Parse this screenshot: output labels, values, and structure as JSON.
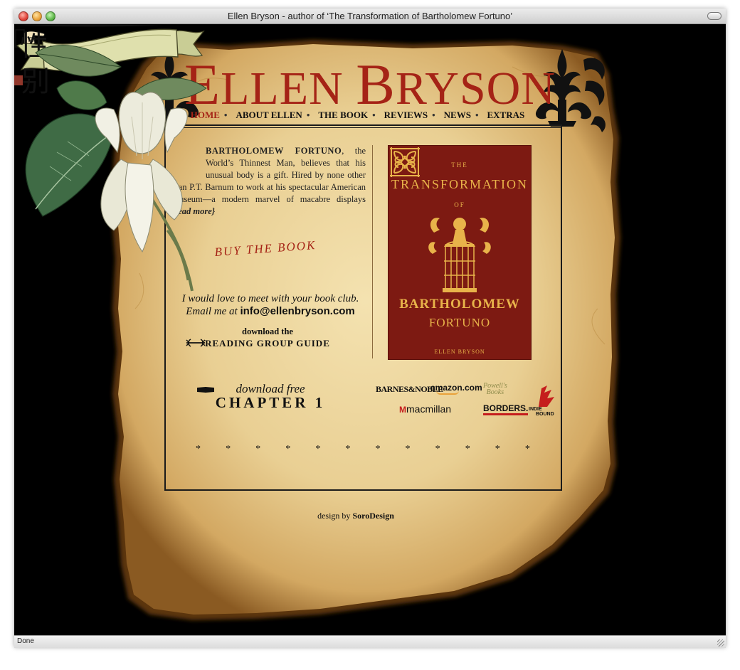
{
  "window": {
    "title": "Ellen Bryson - author of ‘The Transformation of Bartholomew Fortuno’",
    "status": "Done"
  },
  "header": {
    "title_first_cap": "E",
    "title_first_rest": "LLEN",
    "title_second_cap": "B",
    "title_second_rest": "RYSON"
  },
  "nav": {
    "items": [
      {
        "label": "HOME",
        "active": true
      },
      {
        "label": "ABOUT ELLEN"
      },
      {
        "label": "THE BOOK"
      },
      {
        "label": "REVIEWS"
      },
      {
        "label": "NEWS"
      },
      {
        "label": "EXTRAS"
      }
    ],
    "separator": "•"
  },
  "intro": {
    "name": "BARTHOLOMEW FORTUNO",
    "text": ", the World’s Thinnest Man, believes that his unusual body is a gift. Hired by none other than P.T. Barnum to work at his spectacular American Museum—a modern marvel of macabre displays ",
    "read_more": "{read more}"
  },
  "buy": {
    "label": "BUY THE BOOK"
  },
  "bookclub": {
    "line1": "I would love to meet with your book club.",
    "line2_prefix": "Email me at ",
    "email": "info@ellenbryson.com"
  },
  "guide": {
    "line1": "download the",
    "line2": "READING GROUP GUIDE"
  },
  "chapter": {
    "line1": "download free",
    "line2": "CHAPTER 1"
  },
  "cover": {
    "the": "THE",
    "title": "TRANSFORMATION",
    "of": "OF",
    "name1": "BARTHOLOMEW",
    "name2": "FORTUNO",
    "author": "ELLEN BRYSON",
    "colors": {
      "background": "#7d1a12",
      "ink": "#e8b34a"
    }
  },
  "retailers": {
    "bn": "BARNES&NOBLE",
    "amazon": "amazon.com",
    "powells_1": "Powell's",
    "powells_2": "Books",
    "macmillan_mark": "M",
    "macmillan": "macmillan",
    "borders": "BORDERS.",
    "indie_1": "INDIE",
    "indie_2": "BOUND"
  },
  "stars": [
    "*",
    "*",
    "*",
    "*",
    "*",
    "*",
    "*",
    "*",
    "*",
    "*",
    "*",
    "*"
  ],
  "credit": {
    "prefix": "design by ",
    "name": "SoroDesign"
  },
  "calligraphy": {
    "char1": "性",
    "char2": "别"
  },
  "colors": {
    "accent": "#a52316",
    "paper": "#e9cf93",
    "paper_edge": "#8a5a22"
  }
}
